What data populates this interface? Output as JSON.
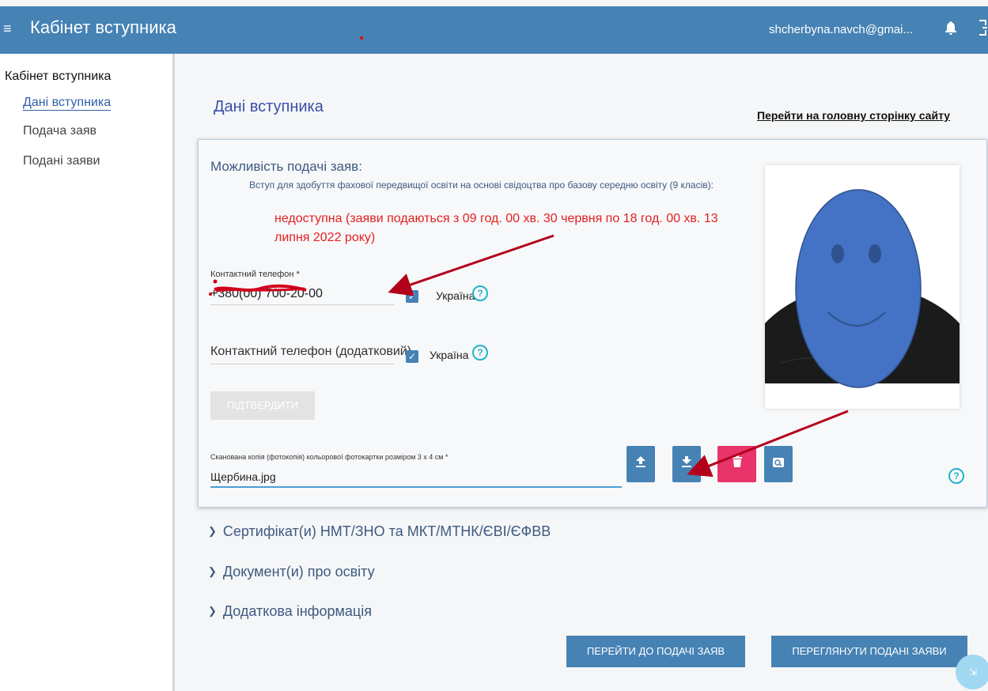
{
  "header": {
    "menu_icon": "≡",
    "title": "Кабінет вступника",
    "user_email": "shcherbyna.navch@gmai...",
    "bell_icon": "bell-icon",
    "exit_icon": "exit-icon"
  },
  "sidebar": {
    "heading": "Кабінет вступника",
    "items": [
      {
        "label": "Дані вступника",
        "active": true
      },
      {
        "label": "Подача заяв",
        "active": false
      },
      {
        "label": "Подані заяви",
        "active": false
      }
    ]
  },
  "main": {
    "page_title": "Дані вступника",
    "home_link": "Перейти на головну сторінку сайту"
  },
  "possibility": {
    "title": "Можливість подачі заяв:",
    "description": "Вступ для здобуття фахової передвищої освіти на основі свідоцтва про базову середню освіту (9 класів):",
    "status": "недоступна (заяви подаються з 09 год. 00 хв. 30 червня по 18 год. 00 хв. 13 липня 2022 року)"
  },
  "phone": {
    "label": "Контактний телефон *",
    "value": "+380(00) 700-20-00",
    "country": "Україна",
    "checked": true
  },
  "phone_extra": {
    "label": "Контактний телефон (додатковий)",
    "country": "Україна",
    "checked": true
  },
  "confirm_button": "ПІДТВЕРДИТИ",
  "scan": {
    "label": "Сканована копія (фотокопія) кольорової фотокартки розміром 3 х 4 см *",
    "value": "Щербина.jpg"
  },
  "accordion": [
    {
      "label": "Сертифікат(и) НМТ/ЗНО та МКТ/МТНК/ЄВІ/ЄФВВ"
    },
    {
      "label": "Документ(и) про освіту"
    },
    {
      "label": "Додаткова інформація"
    }
  ],
  "actions": {
    "go_to_apply": "ПЕРЕЙТИ ДО ПОДАЧІ ЗАЯВ",
    "view_applications": "ПЕРЕГЛЯНУТИ ПОДАНІ ЗАЯВИ"
  },
  "colors": {
    "primary": "#4682b4",
    "delete": "#e8336b",
    "status_red": "#e32020",
    "help": "#1fb5c9",
    "annotation_arrow": "#b3001b"
  }
}
